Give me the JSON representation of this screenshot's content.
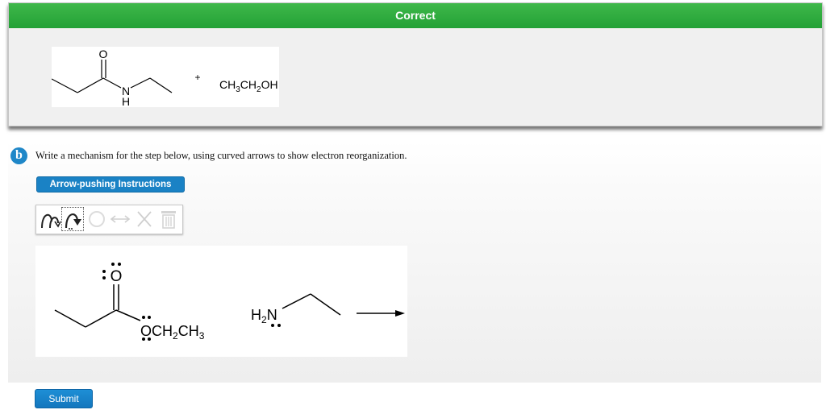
{
  "status": {
    "label": "Correct",
    "color": "#23a136"
  },
  "answer": {
    "reactant1": {
      "atom_o": "O",
      "atom_n": "N",
      "atom_h": "H"
    },
    "plus": "+",
    "reactant2": {
      "ch3": "CH",
      "sub3": "3",
      "ch2": "CH",
      "sub2": "2",
      "oh": "OH"
    }
  },
  "part": {
    "letter": "b",
    "badge_color": "#1f87c8"
  },
  "question": {
    "text": "Write a mechanism for the step below, using curved arrows to show electron reorganization."
  },
  "instructions_button": {
    "label": "Arrow-pushing Instructions"
  },
  "toolbar": {
    "tools": [
      {
        "icon": "curved-arrow-pair-icon",
        "enabled": true
      },
      {
        "icon": "curved-arrow-single-icon",
        "enabled": true,
        "selected": true
      },
      {
        "icon": "circle-icon",
        "enabled": false
      },
      {
        "icon": "double-arrow-icon",
        "enabled": false
      },
      {
        "icon": "x-delete-icon",
        "enabled": false
      },
      {
        "icon": "trash-icon",
        "enabled": false
      }
    ]
  },
  "problem": {
    "carbonyl_o": "O",
    "ester_o": "O",
    "ester_tail": {
      "ch2": "CH",
      "sub2": "2",
      "ch3": "CH",
      "sub3": "3"
    },
    "amine": {
      "h": "H",
      "sub2": "2",
      "n": "N"
    }
  },
  "submit_button": {
    "label": "Submit"
  }
}
